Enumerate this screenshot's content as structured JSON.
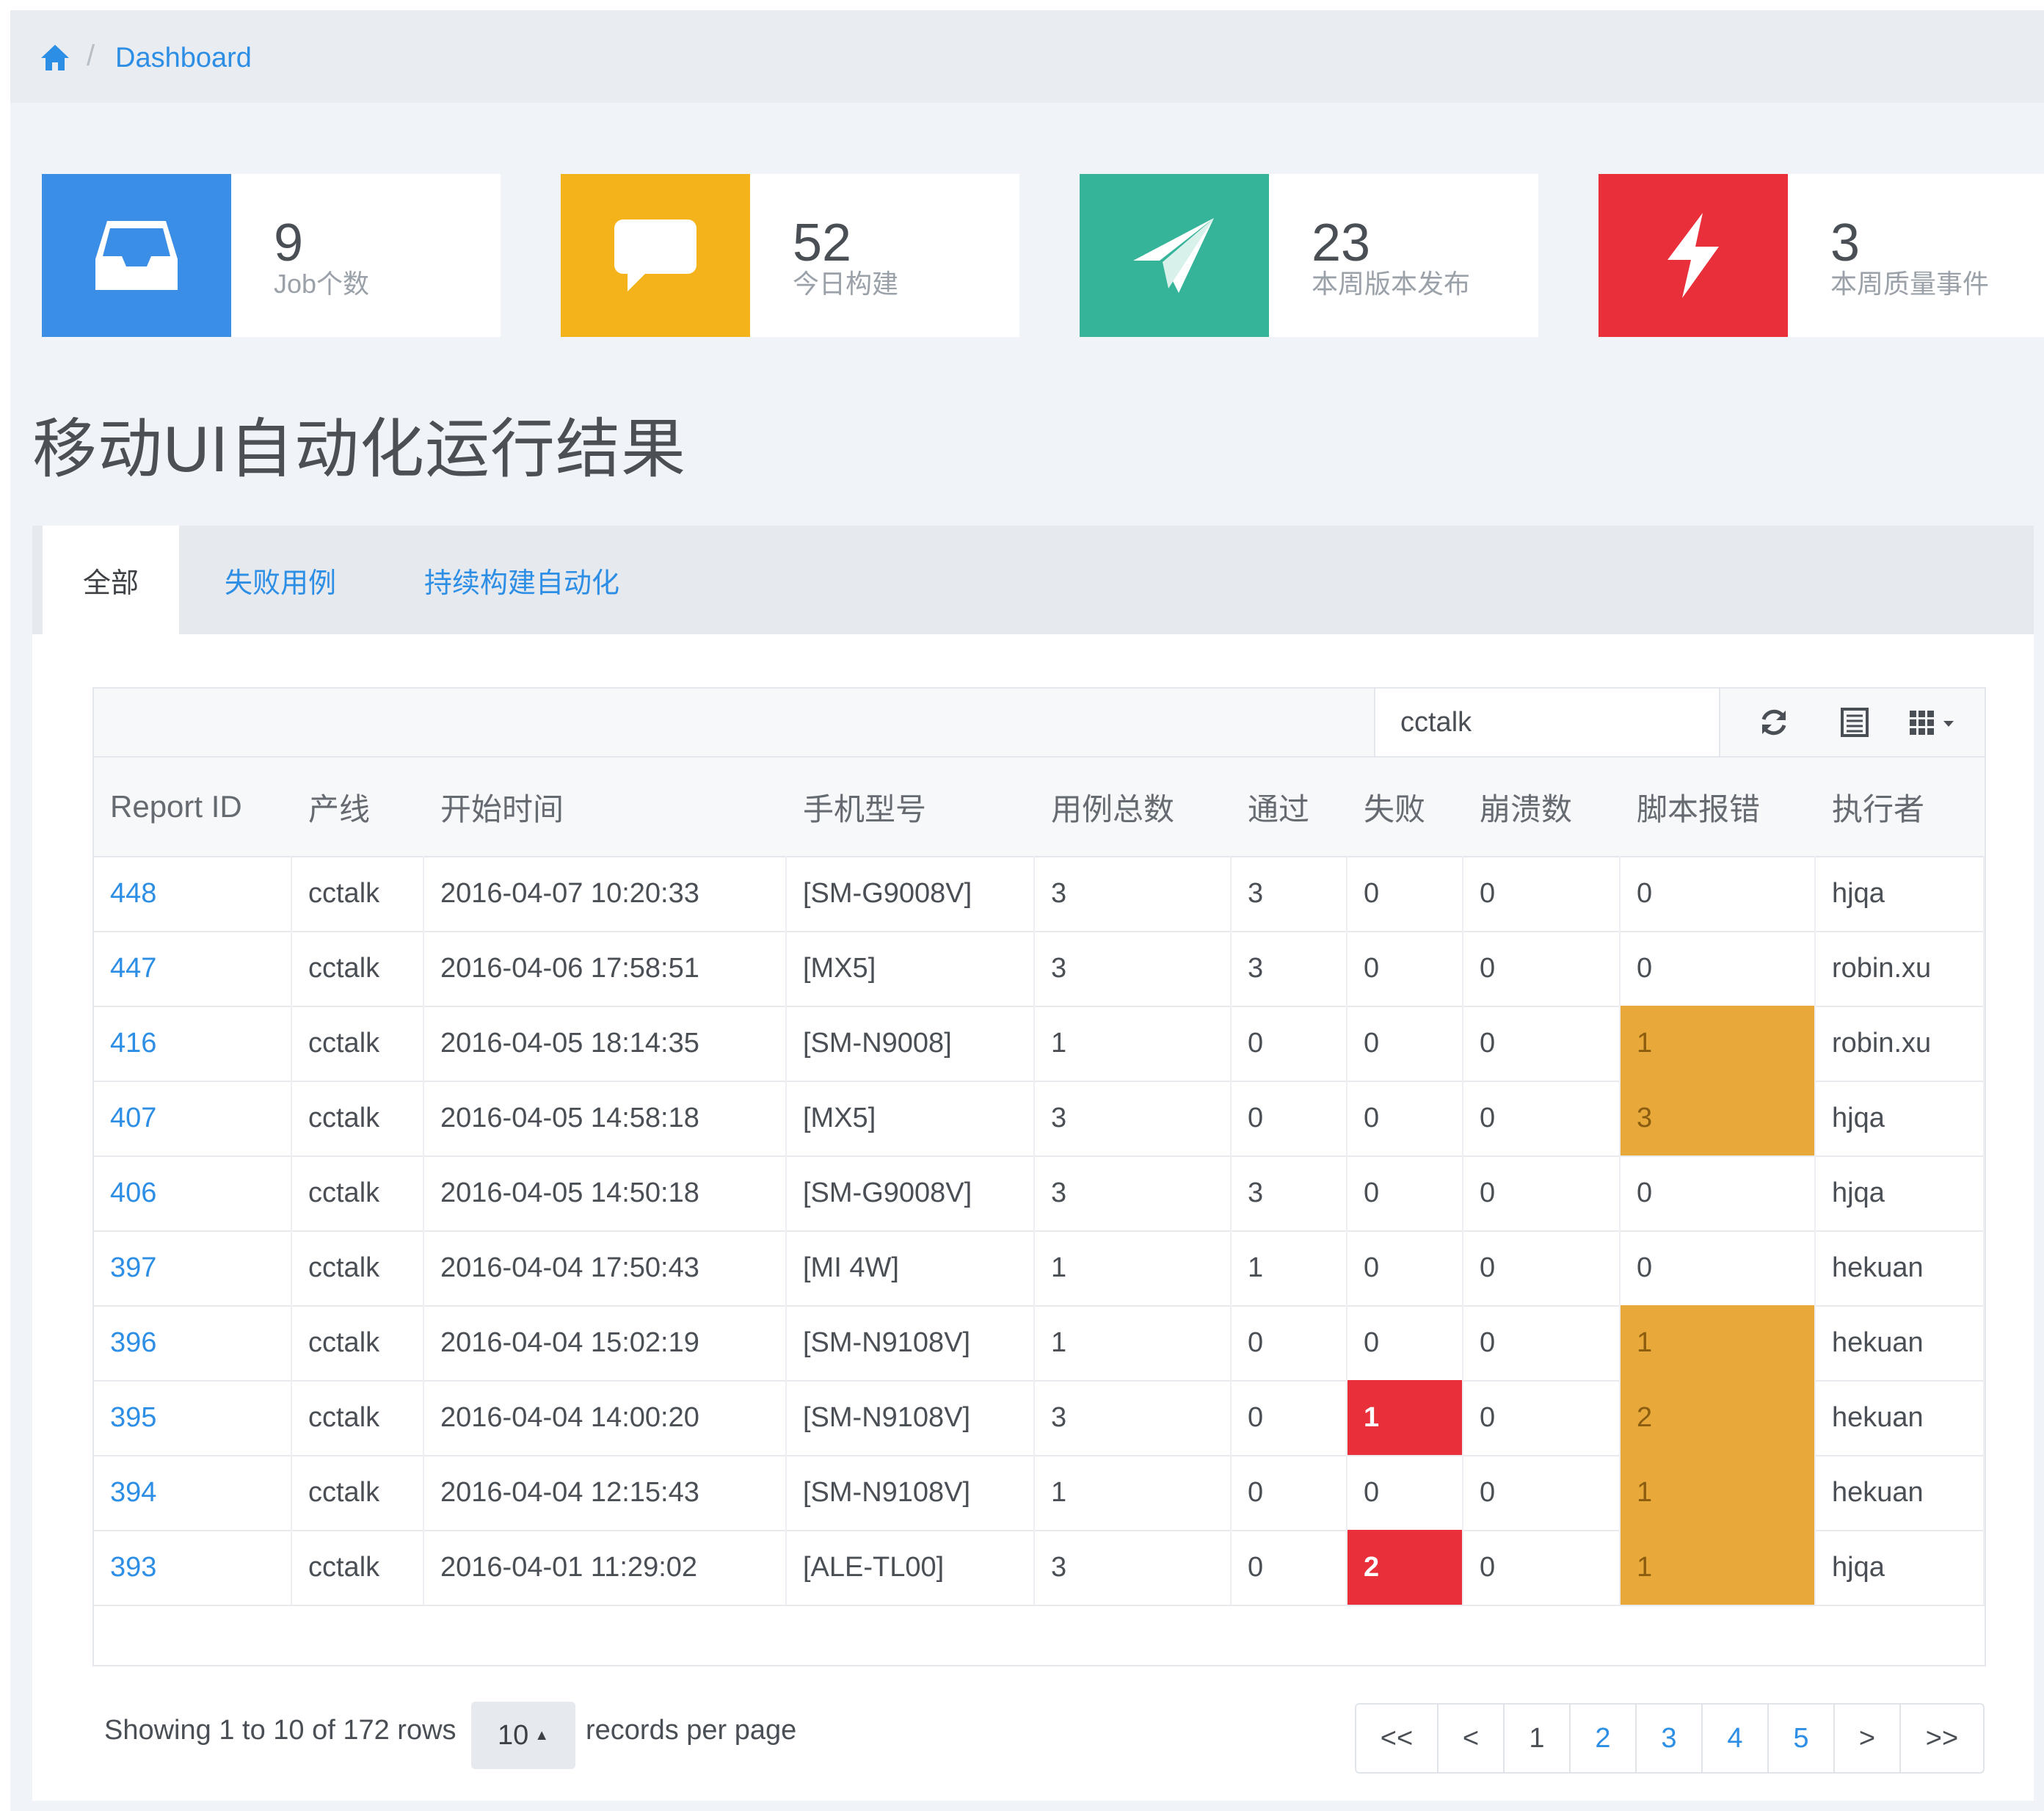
{
  "breadcrumb": {
    "home_icon": "home-icon",
    "separator": "/",
    "current": "Dashboard"
  },
  "stats": [
    {
      "number": "9",
      "label": "Job个数",
      "color": "#3a8ee6",
      "icon": "inbox-icon"
    },
    {
      "number": "52",
      "label": "今日构建",
      "color": "#f4b21b",
      "icon": "comment-icon"
    },
    {
      "number": "23",
      "label": "本周版本发布",
      "color": "#36b49a",
      "icon": "paper-plane-icon"
    },
    {
      "number": "3",
      "label": "本周质量事件",
      "color": "#e9303a",
      "icon": "bolt-icon"
    }
  ],
  "page_title": "移动UI自动化运行结果",
  "tabs": [
    {
      "label": "全部",
      "active": true
    },
    {
      "label": "失败用例",
      "active": false
    },
    {
      "label": "持续构建自动化",
      "active": false
    }
  ],
  "toolbar": {
    "search_value": "cctalk",
    "refresh_icon": "refresh-icon",
    "list_icon": "list-view-icon",
    "columns_icon": "columns-grid-icon"
  },
  "table": {
    "headers": [
      "Report ID",
      "产线",
      "开始时间",
      "手机型号",
      "用例总数",
      "通过",
      "失败",
      "崩溃数",
      "脚本报错",
      "执行者"
    ],
    "rows": [
      [
        "448",
        "cctalk",
        "2016-04-07 10:20:33",
        "[SM-G9008V]",
        "3",
        "3",
        "0",
        "0",
        "0",
        "hjqa"
      ],
      [
        "447",
        "cctalk",
        "2016-04-06 17:58:51",
        "[MX5]",
        "3",
        "3",
        "0",
        "0",
        "0",
        "robin.xu"
      ],
      [
        "416",
        "cctalk",
        "2016-04-05 18:14:35",
        "[SM-N9008]",
        "1",
        "0",
        "0",
        "0",
        "1",
        "robin.xu"
      ],
      [
        "407",
        "cctalk",
        "2016-04-05 14:58:18",
        "[MX5]",
        "3",
        "0",
        "0",
        "0",
        "3",
        "hjqa"
      ],
      [
        "406",
        "cctalk",
        "2016-04-05 14:50:18",
        "[SM-G9008V]",
        "3",
        "3",
        "0",
        "0",
        "0",
        "hjqa"
      ],
      [
        "397",
        "cctalk",
        "2016-04-04 17:50:43",
        "[MI 4W]",
        "1",
        "1",
        "0",
        "0",
        "0",
        "hekuan"
      ],
      [
        "396",
        "cctalk",
        "2016-04-04 15:02:19",
        "[SM-N9108V]",
        "1",
        "0",
        "0",
        "0",
        "1",
        "hekuan"
      ],
      [
        "395",
        "cctalk",
        "2016-04-04 14:00:20",
        "[SM-N9108V]",
        "3",
        "0",
        "1",
        "0",
        "2",
        "hekuan"
      ],
      [
        "394",
        "cctalk",
        "2016-04-04 12:15:43",
        "[SM-N9108V]",
        "1",
        "0",
        "0",
        "0",
        "1",
        "hekuan"
      ],
      [
        "393",
        "cctalk",
        "2016-04-01 11:29:02",
        "[ALE-TL00]",
        "3",
        "0",
        "2",
        "0",
        "1",
        "hjqa"
      ]
    ],
    "highlight_colors": {
      "failure": "#e9303a",
      "script_error": "#e9a93a"
    }
  },
  "footer": {
    "showing": "Showing 1 to 10 of 172 rows",
    "page_size": "10",
    "page_size_caret": "▲",
    "per_page": "records per page"
  },
  "pagination": [
    "<<",
    "<",
    "1",
    "2",
    "3",
    "4",
    "5",
    ">",
    ">>"
  ]
}
